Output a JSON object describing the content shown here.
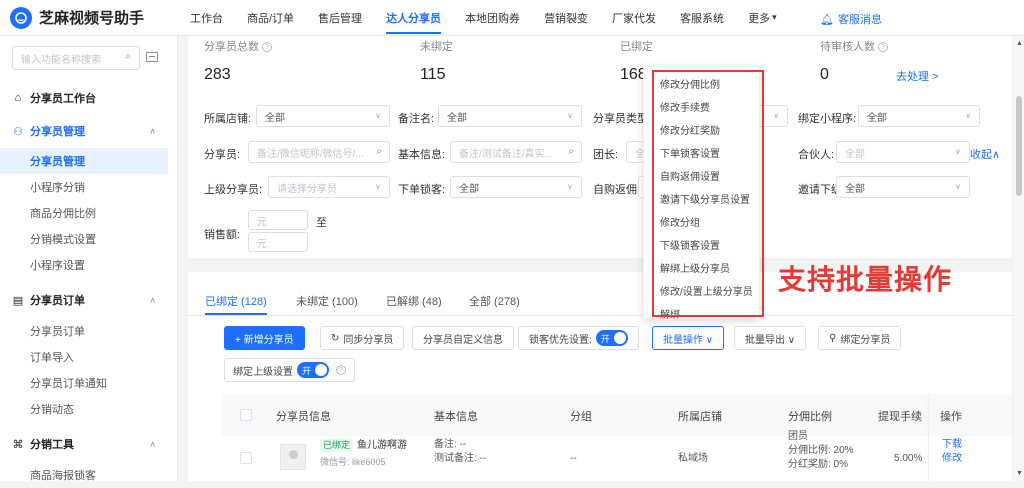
{
  "app": {
    "name": "芝麻视频号助手"
  },
  "nav": {
    "items": [
      "工作台",
      "商品/订单",
      "售后管理",
      "达人分享员",
      "本地团购券",
      "营销裂变",
      "厂家代发",
      "客服系统",
      "更多"
    ],
    "active_index": 3,
    "more_arrow": "▾",
    "message": "客服消息"
  },
  "sidebar": {
    "search_placeholder": "输入功能名称搜索",
    "groups": [
      {
        "label": "分享员工作台",
        "icon": "home-icon",
        "items": []
      },
      {
        "label": "分享员管理",
        "icon": "users-icon",
        "items": [
          "分享员管理",
          "小程序分销",
          "商品分佣比例",
          "分销模式设置",
          "小程序设置"
        ]
      },
      {
        "label": "分享员订单",
        "icon": "order-icon",
        "items": [
          "分享员订单",
          "订单导入",
          "分享员订单通知",
          "分销动态"
        ]
      },
      {
        "label": "分销工具",
        "icon": "tools-icon",
        "items": [
          "商品海报锁客"
        ]
      }
    ],
    "active_item": "分享员管理"
  },
  "stats": [
    {
      "label": "分享员总数",
      "value": "283",
      "has_help": true
    },
    {
      "label": "未绑定",
      "value": "115",
      "has_help": false
    },
    {
      "label": "已绑定",
      "value": "168",
      "has_help": false
    },
    {
      "label": "待审核人数",
      "value": "0",
      "has_help": true,
      "link": "去处理 >"
    }
  ],
  "filters": {
    "row1": [
      {
        "label": "所属店铺:",
        "value": "全部"
      },
      {
        "label": "备注名:",
        "value": "全部"
      },
      {
        "label": "分享员类型",
        "value": "",
        "has_help": true
      },
      {
        "label": "绑定小程序:",
        "value": "全部"
      }
    ],
    "row2": [
      {
        "label": "分享员:",
        "placeholder": "备注/微信昵称/微信号/..."
      },
      {
        "label": "基本信息:",
        "placeholder": "备注/测试备注/真实..."
      },
      {
        "label": "团长:",
        "placeholder": "全"
      },
      {
        "label": "合伙人:",
        "placeholder": "全部"
      }
    ],
    "collapse": "收起∧",
    "row3": [
      {
        "label": "上级分享员:",
        "placeholder": "请选择分享员"
      },
      {
        "label": "下单锁客:",
        "value": "全部"
      },
      {
        "label": "自购返佣:",
        "value": ""
      },
      {
        "label": "邀请下级:",
        "value": "全部"
      }
    ],
    "sales": {
      "label": "销售额:",
      "min_placeholder": "元",
      "to": "至",
      "max_placeholder": "元"
    }
  },
  "tabs": [
    {
      "label": "已绑定 (128)",
      "active": true
    },
    {
      "label": "未绑定 (100)",
      "active": false
    },
    {
      "label": "已解绑 (48)",
      "active": false
    },
    {
      "label": "全部 (278)",
      "active": false
    }
  ],
  "toolbar": {
    "add": "+ 新增分享员",
    "sync": "同步分享员",
    "custom": "分享员自定义信息",
    "lock_priority": "锁客优先设置:",
    "toggle_label": "开",
    "batch": "批量操作 ∨",
    "export": "批量导出 ∨",
    "bind": "绑定分享员",
    "bind_parent": "绑定上级设置"
  },
  "table": {
    "headers": [
      "分享员信息",
      "基本信息",
      "分组",
      "所属店铺",
      "分佣比例",
      "提现手续",
      "操作"
    ],
    "rows": [
      {
        "status": "已绑定",
        "name": "鱼儿游啊游",
        "wechat": "微信号: like6005",
        "note": "备注: --",
        "test_note": "测试备注: --",
        "group": "--",
        "shop": "私域场",
        "commission_type": "团员",
        "commission_rate": "分佣比例: 20%",
        "commission_extra": "分红奖励: 0%",
        "fee": "5.00%",
        "actions": [
          "下载",
          "修改"
        ]
      }
    ]
  },
  "batch_menu": {
    "items": [
      "修改分佣比例",
      "修改手续费",
      "修改分红奖励",
      "下单锁客设置",
      "自购返佣设置",
      "邀请下级分享员设置",
      "修改分组",
      "下级锁客设置",
      "解绑上级分享员",
      "修改/设置上级分享员",
      "解绑"
    ]
  },
  "annotation": "支持批量操作",
  "colors": {
    "accent": "#1e6fff",
    "annotation": "#e53935"
  }
}
